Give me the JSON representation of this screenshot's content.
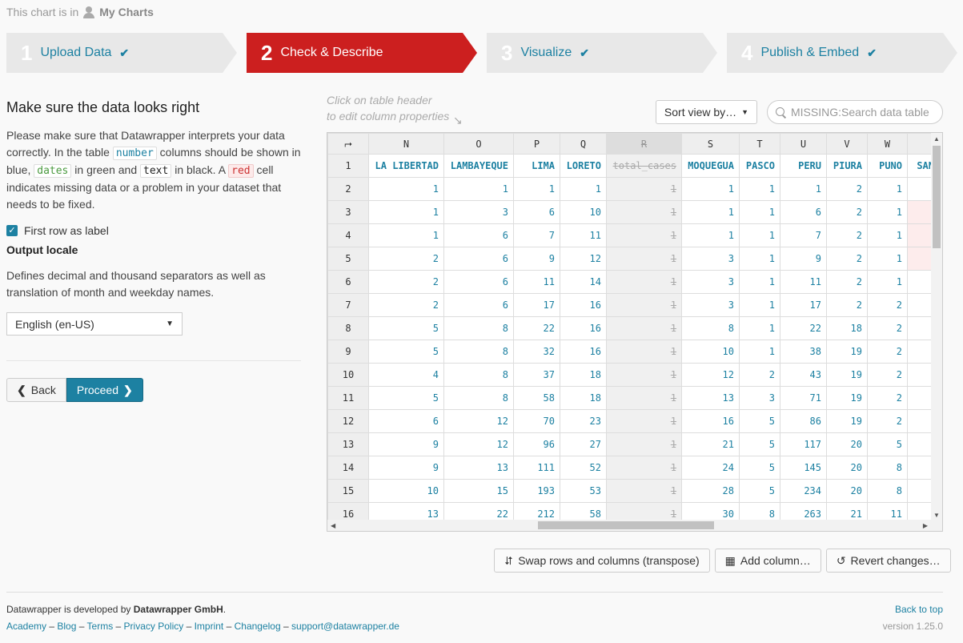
{
  "location": {
    "prefix": "This chart is in",
    "folder": "My Charts"
  },
  "steps": [
    {
      "num": "1",
      "label": "Upload Data",
      "done": true
    },
    {
      "num": "2",
      "label": "Check & Describe",
      "done": false
    },
    {
      "num": "3",
      "label": "Visualize",
      "done": true
    },
    {
      "num": "4",
      "label": "Publish & Embed",
      "done": true
    }
  ],
  "left": {
    "title": "Make sure the data looks right",
    "intro_1": "Please make sure that Datawrapper interprets your data correctly. In the table ",
    "code_number": "number",
    "intro_2": " columns should be shown in blue, ",
    "code_dates": "dates",
    "intro_3": " in green and ",
    "code_text": "text",
    "intro_4": " in black. A ",
    "code_red": "red",
    "intro_5": " cell indicates missing data or a problem in your dataset that needs to be fixed.",
    "first_row_label": "First row as label",
    "output_locale_title": "Output locale",
    "output_locale_desc": "Defines decimal and thousand separators as well as translation of month and weekday names.",
    "locale_value": "English (en-US)",
    "back_label": "Back",
    "proceed_label": "Proceed"
  },
  "table_tools": {
    "hint_line1": "Click on table header",
    "hint_line2": "to edit column properties",
    "sort_label": "Sort view by…",
    "search_placeholder": "MISSING:Search data table"
  },
  "table": {
    "columns": [
      "N",
      "O",
      "P",
      "Q",
      "R",
      "S",
      "T",
      "U",
      "V",
      "W",
      ""
    ],
    "headers": [
      "LA LIBERTAD",
      "LAMBAYEQUE",
      "LIMA",
      "LORETO",
      "total_cases",
      "MOQUEGUA",
      "PASCO",
      "PERU",
      "PIURA",
      "PUNO",
      "SAN"
    ],
    "rows": [
      {
        "n": "2",
        "cells": [
          "1",
          "1",
          "1",
          "1",
          "1",
          "1",
          "1",
          "1",
          "2",
          "1",
          ""
        ]
      },
      {
        "n": "3",
        "cells": [
          "1",
          "3",
          "6",
          "10",
          "1",
          "1",
          "1",
          "6",
          "2",
          "1",
          ""
        ]
      },
      {
        "n": "4",
        "cells": [
          "1",
          "6",
          "7",
          "11",
          "1",
          "1",
          "1",
          "7",
          "2",
          "1",
          ""
        ]
      },
      {
        "n": "5",
        "cells": [
          "2",
          "6",
          "9",
          "12",
          "1",
          "3",
          "1",
          "9",
          "2",
          "1",
          ""
        ]
      },
      {
        "n": "6",
        "cells": [
          "2",
          "6",
          "11",
          "14",
          "1",
          "3",
          "1",
          "11",
          "2",
          "1",
          ""
        ]
      },
      {
        "n": "7",
        "cells": [
          "2",
          "6",
          "17",
          "16",
          "1",
          "3",
          "1",
          "17",
          "2",
          "2",
          ""
        ]
      },
      {
        "n": "8",
        "cells": [
          "5",
          "8",
          "22",
          "16",
          "1",
          "8",
          "1",
          "22",
          "18",
          "2",
          ""
        ]
      },
      {
        "n": "9",
        "cells": [
          "5",
          "8",
          "32",
          "16",
          "1",
          "10",
          "1",
          "38",
          "19",
          "2",
          ""
        ]
      },
      {
        "n": "10",
        "cells": [
          "4",
          "8",
          "37",
          "18",
          "1",
          "12",
          "2",
          "43",
          "19",
          "2",
          ""
        ]
      },
      {
        "n": "11",
        "cells": [
          "5",
          "8",
          "58",
          "18",
          "1",
          "13",
          "3",
          "71",
          "19",
          "2",
          ""
        ]
      },
      {
        "n": "12",
        "cells": [
          "6",
          "12",
          "70",
          "23",
          "1",
          "16",
          "5",
          "86",
          "19",
          "2",
          ""
        ]
      },
      {
        "n": "13",
        "cells": [
          "9",
          "12",
          "96",
          "27",
          "1",
          "21",
          "5",
          "117",
          "20",
          "5",
          ""
        ]
      },
      {
        "n": "14",
        "cells": [
          "9",
          "13",
          "111",
          "52",
          "1",
          "24",
          "5",
          "145",
          "20",
          "8",
          ""
        ]
      },
      {
        "n": "15",
        "cells": [
          "10",
          "15",
          "193",
          "53",
          "1",
          "28",
          "5",
          "234",
          "20",
          "8",
          ""
        ]
      },
      {
        "n": "16",
        "cells": [
          "13",
          "22",
          "212",
          "58",
          "1",
          "30",
          "8",
          "263",
          "21",
          "11",
          ""
        ]
      }
    ]
  },
  "actions": {
    "transpose": "Swap rows and columns (transpose)",
    "add_column": "Add column…",
    "revert": "Revert changes…"
  },
  "footer": {
    "dev_prefix": "Datawrapper is developed by ",
    "dev_company": "Datawrapper GmbH",
    "dev_suffix": ".",
    "links": [
      "Academy",
      "Blog",
      "Terms",
      "Privacy Policy",
      "Imprint",
      "Changelog",
      "support@datawrapper.de"
    ],
    "back_to_top": "Back to top",
    "version": "version 1.25.0"
  },
  "colors": {
    "accent": "#1d81a2",
    "active_step": "#cc1f1f"
  }
}
